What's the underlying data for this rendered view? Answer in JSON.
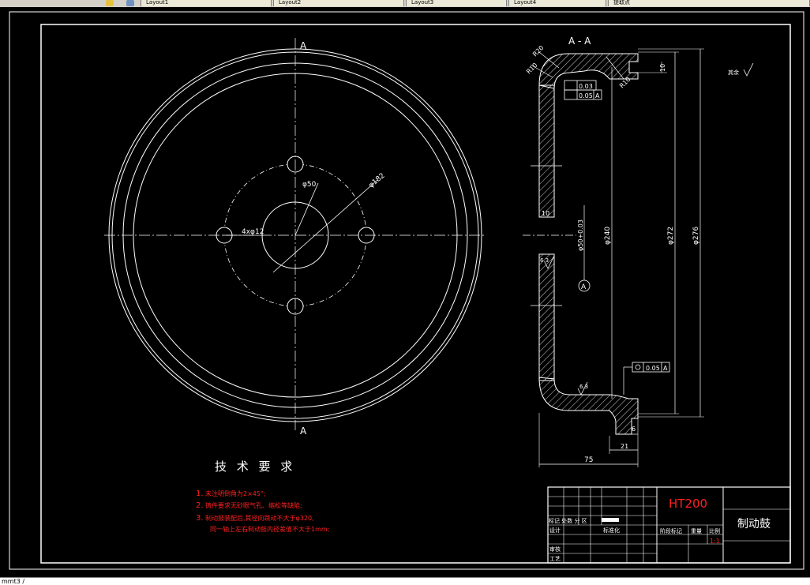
{
  "tabs": [
    {
      "label": "Layout1"
    },
    {
      "label": "Layout2"
    },
    {
      "label": "Layout3"
    },
    {
      "label": "Layout4"
    },
    {
      "label": "提取点"
    }
  ],
  "front_view": {
    "section_mark_top": "A",
    "section_mark_bottom": "A",
    "dim_phi50": "φ50",
    "dim_phi182": "φ182",
    "dim_holes": "4xφ12"
  },
  "section_view": {
    "title": "A - A",
    "r20": "R20",
    "r10_left": "R10",
    "r10_right": "R10",
    "dim_10_top": "10",
    "tol_runout": "0.03",
    "tol_parallel": "0.05",
    "tol_datum_a": "A",
    "dim_10_mid": "10",
    "dim_bore": "φ50+0.03",
    "rough_1": "6.3",
    "datum_label": "A",
    "dim_240": "φ240",
    "dim_272": "φ272",
    "dim_276": "φ276",
    "tol_bottom_value": "0.05",
    "tol_bottom_datum": "A",
    "rough_2": "6.3",
    "dim_6": "6",
    "dim_21": "21",
    "dim_75": "75",
    "surface_note": "其余"
  },
  "requirements": {
    "title": "技 术 要 求",
    "items": [
      {
        "num": "1.",
        "text": "未注明倒角为2×45°;"
      },
      {
        "num": "2.",
        "text": "铸件要求无砂眼气孔、缩松等缺陷;"
      },
      {
        "num": "3.",
        "text": "制动鼓装配后,其径向跳动不大于φ320,"
      },
      {
        "num": "",
        "text": "同一轴上左右制动鼓内径差值不大于1mm;"
      }
    ]
  },
  "title_block": {
    "material": "HT200",
    "part_name": "制动鼓",
    "row_marks": "标记 处数 分  区",
    "design": "设计",
    "standardize": "标准化",
    "review": "审核",
    "process": "工艺",
    "stage_mark": "阶段标记",
    "weight": "重量",
    "scale_label": "比例",
    "scale_value": "1:1"
  },
  "statusbar": {
    "text": "mmt3 /"
  }
}
